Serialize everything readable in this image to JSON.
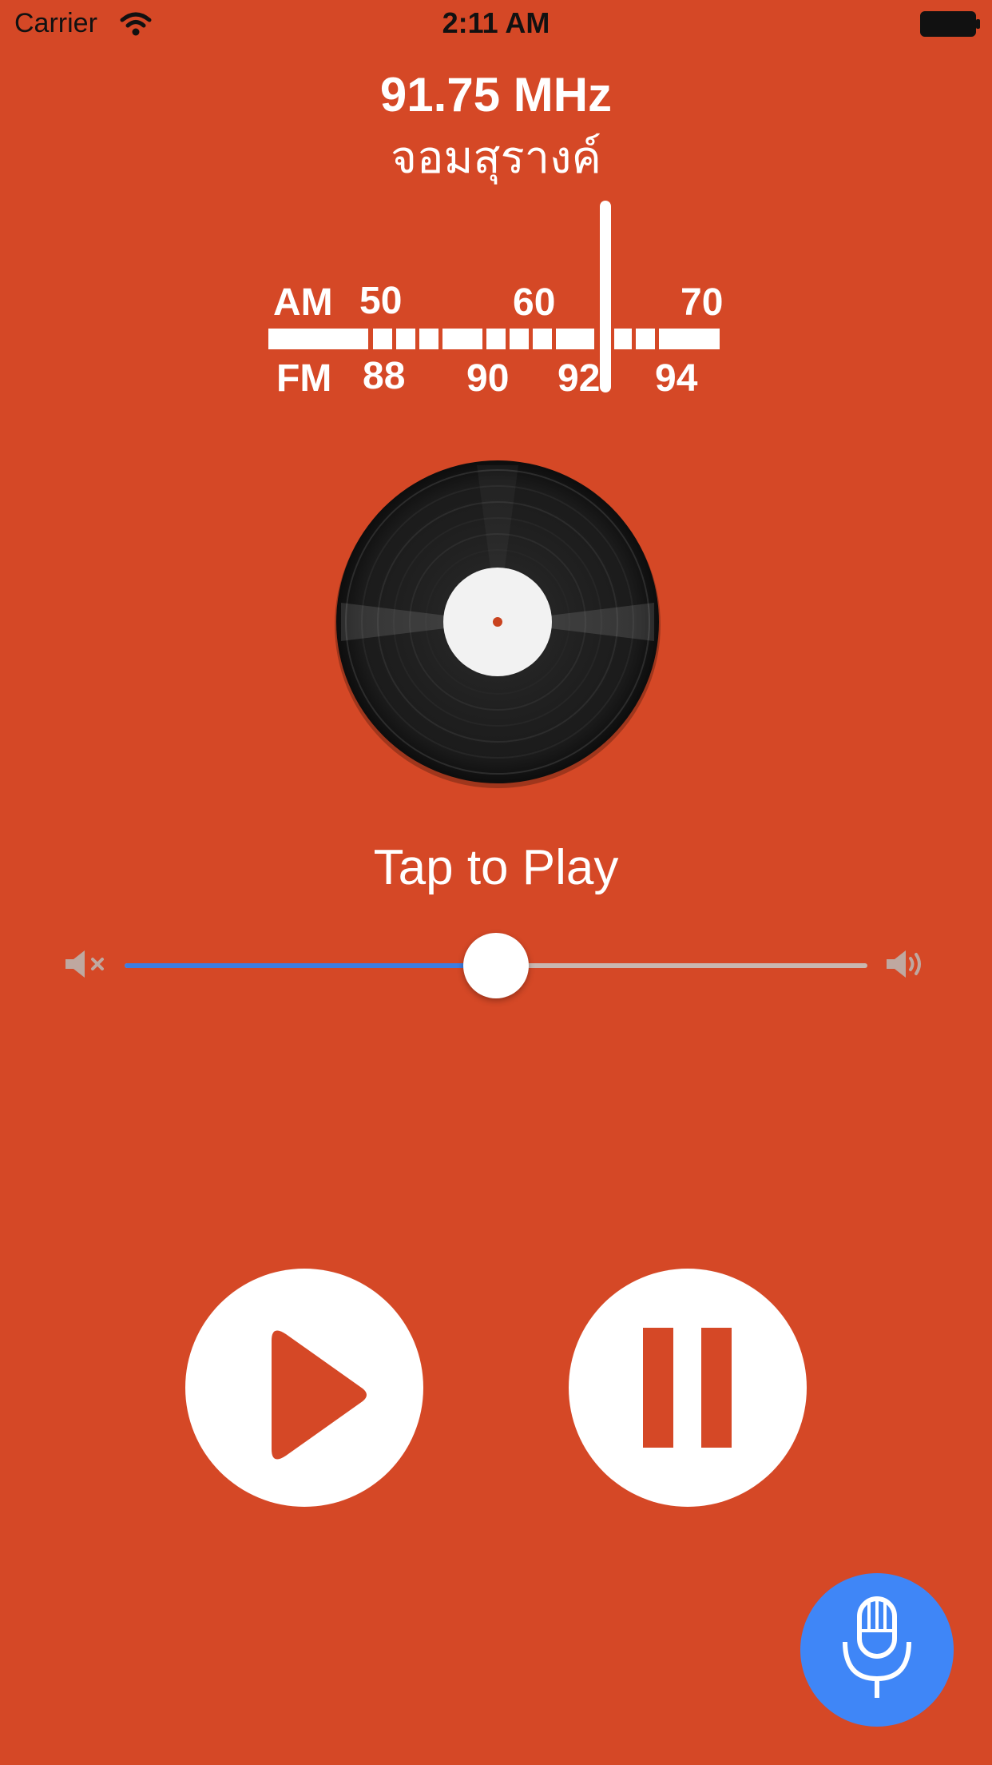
{
  "status_bar": {
    "carrier": "Carrier",
    "time": "2:11 AM"
  },
  "station": {
    "frequency": "91.75 MHz",
    "name": "จอมสุรางค์"
  },
  "tuner": {
    "am_label": "AM",
    "fm_label": "FM",
    "am_ticks": [
      "50",
      "60",
      "70"
    ],
    "fm_ticks": [
      "88",
      "90",
      "92",
      "94"
    ],
    "current_fm_value": 91.75
  },
  "player": {
    "tap_to_play": "Tap to Play"
  },
  "volume": {
    "level": 0.5
  },
  "colors": {
    "background": "#d54826",
    "accent_blue": "#3d7de2",
    "mic_blue": "#3f86f7"
  },
  "icons": {
    "mute": "speaker-muted-icon",
    "speaker": "speaker-volume-icon",
    "play": "play-icon",
    "pause": "pause-icon",
    "mic": "microphone-icon",
    "wifi": "wifi-icon",
    "battery": "battery-icon"
  }
}
